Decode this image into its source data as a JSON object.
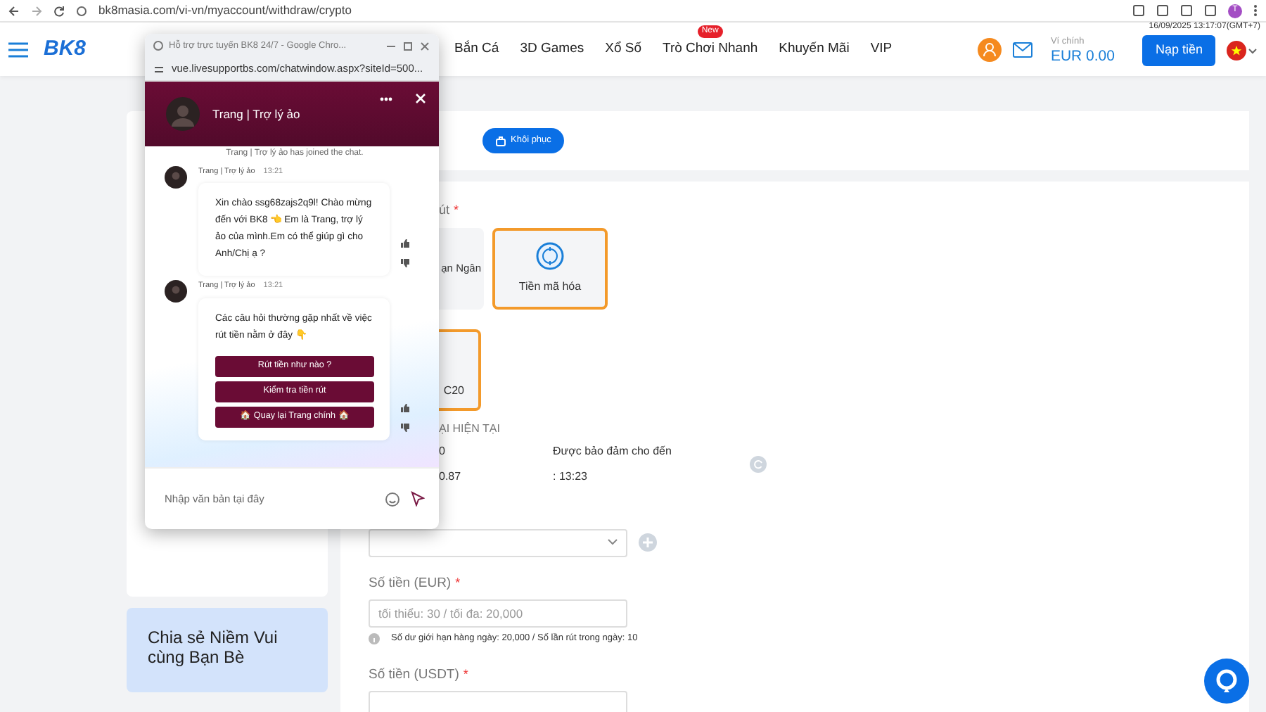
{
  "browser": {
    "url": "bk8masia.com/vi-vn/myaccount/withdraw/crypto",
    "profile_initial": "T"
  },
  "header": {
    "logo": "BK8",
    "nav": [
      {
        "label": "Bắn Cá"
      },
      {
        "label": "3D Games"
      },
      {
        "label": "Xổ Số"
      },
      {
        "label": "Trò Chơi Nhanh",
        "badge": "New"
      },
      {
        "label": "Khuyến Mãi"
      },
      {
        "label": "VIP"
      }
    ],
    "datetime": "16/09/2025 13:17:07(GMT+7)",
    "wallet_label": "Ví chính",
    "balance": "EUR 0.00",
    "deposit_button": "Nạp tiền"
  },
  "chat_window": {
    "title": "Hỗ trợ trực tuyến BK8 24/7 - Google Chro...",
    "url": "vue.livesupportbs.com/chatwindow.aspx?siteId=500...",
    "agent_name": "Trang | Trợ lý ảo",
    "joined_notice": "Trang | Trợ lý ảo has joined the chat.",
    "messages": [
      {
        "sender": "Trang | Trợ lý ảo",
        "time": "13:21",
        "text": "Xin chào  ssg68zajs2q9l! Chào mừng đến với BK8 👈 Em là Trang, trợ lý ảo của mình.Em có thể giúp gì cho Anh/Chị ạ ?"
      },
      {
        "sender": "Trang | Trợ lý ảo",
        "time": "13:21",
        "text": "Các câu hỏi thường gặp nhất về việc rút tiền nằm ở đây 👇",
        "quick_replies": [
          "Rút tiền như nào ?",
          "Kiểm tra tiền rút",
          "🏠 Quay lại Trang chính 🏠"
        ]
      }
    ],
    "input_placeholder": "Nhập văn bản tại đây"
  },
  "page": {
    "restore_button": "Khôi phục",
    "method_label": "út",
    "method_required_mark": "*",
    "methods": [
      {
        "label": "ạn Ngân",
        "selected": false
      },
      {
        "label": "Tiền mã hóa",
        "selected": true
      }
    ],
    "networks": [
      {
        "label": "C20",
        "selected": true
      }
    ],
    "rate_heading": "ẠI HIỆN TẠI",
    "rate_label": "0",
    "rate_value": "0.87",
    "guarantee_label": "Được bảo đảm cho đến",
    "guarantee_value": ": 13:23",
    "fields": [
      {
        "label": "Số tiền (EUR)",
        "required_mark": "*",
        "placeholder": "tối thiểu: 30 / tối đa: 20,000",
        "hint": "Số dư giới hạn hàng ngày: 20,000 / Số lần rút trong ngày: 10"
      },
      {
        "label": "Số tiền (USDT)",
        "required_mark": "*"
      }
    ]
  },
  "sidebar": {
    "promo_title": "Chia sẻ Niềm Vui cùng Bạn Bè"
  }
}
